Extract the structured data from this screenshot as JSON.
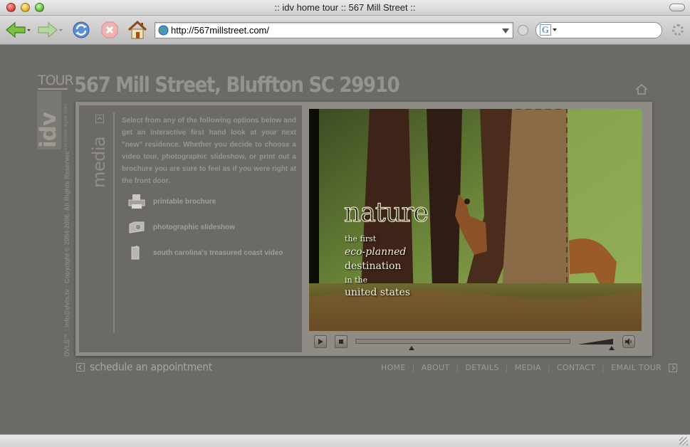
{
  "browser": {
    "window_title": ":: idv home tour :: 567 Mill Street ::",
    "url": "http://567millstreet.com/",
    "search_engine_label": "G",
    "search_placeholder": ""
  },
  "site": {
    "logo_tour": "TOUR",
    "logo_idv": "idv",
    "logo_tagline": "interactive digital video",
    "copyright": "DVLS™ : info@dvls.tv : Copyright © 2004-2006. All Rights Reserved.",
    "title": "567 Mill Street, Bluffton SC 29910"
  },
  "media_panel": {
    "section_label": "media",
    "intro": "Select from any of the following options below and get an interactive first hand look at your next \"new\" residence. Whether you decide to choose a video tour, photographic slideshow, or print out a brochure you are sure to feel as if you were right at the front door.",
    "options": [
      {
        "label": "printable brochure",
        "icon": "printer-icon"
      },
      {
        "label": "photographic slideshow",
        "icon": "camera-icon"
      },
      {
        "label": "south carolina's treasured coast video",
        "icon": "video-camera-icon"
      }
    ]
  },
  "video": {
    "title_word": "nature",
    "lines": [
      "the first",
      "eco-planned",
      "destination",
      "in the",
      "united states"
    ],
    "progress": 0.26,
    "volume": 0.95
  },
  "footer": {
    "schedule_label": "schedule an appointment",
    "nav": [
      "HOME",
      "ABOUT",
      "DETAILS",
      "MEDIA",
      "CONTACT",
      "EMAIL TOUR"
    ]
  }
}
